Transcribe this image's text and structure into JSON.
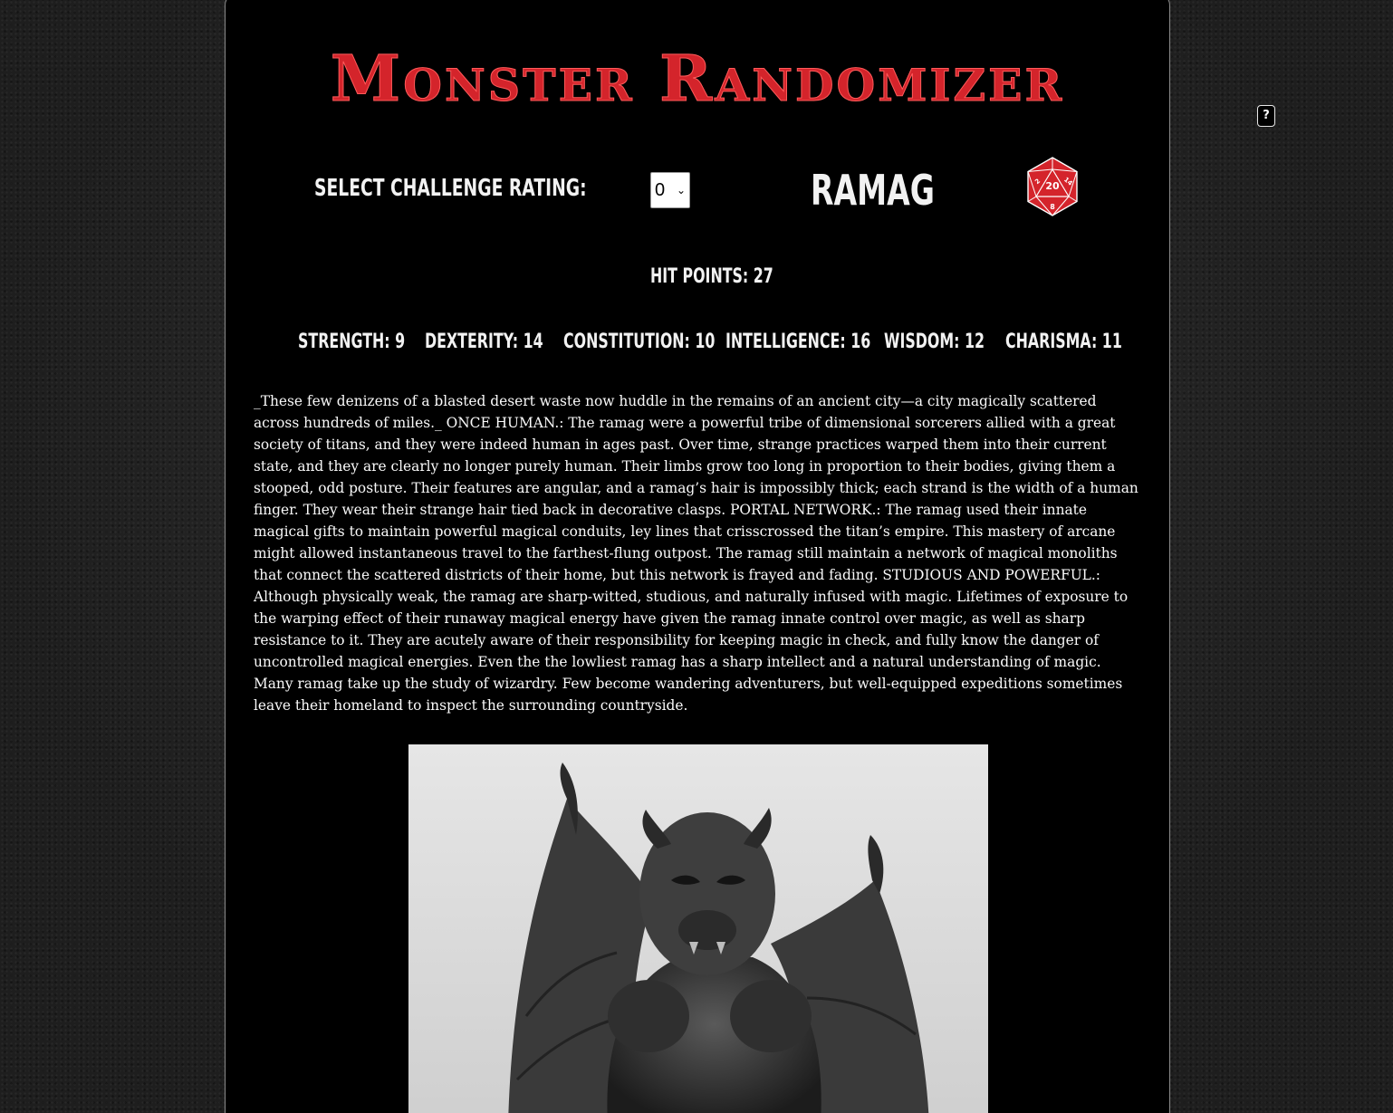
{
  "header": {
    "title": "Monster Randomizer"
  },
  "controls": {
    "challenge_rating_label": "Select Challenge Rating:",
    "challenge_rating_value": "0",
    "help_label": "?",
    "die_label": "20",
    "die_face_numbers": [
      "2",
      "14",
      "8"
    ]
  },
  "monster": {
    "name": "Ramag",
    "hit_points": "Hit Points: 27",
    "stats": [
      {
        "label": "Strength: 9"
      },
      {
        "label": "Dexterity: 14"
      },
      {
        "label": "Constitution: 10"
      },
      {
        "label": "Intelligence: 16"
      },
      {
        "label": "Wisdom: 12"
      },
      {
        "label": "Charisma: 11"
      }
    ],
    "description": "_These few denizens of a blasted desert waste now huddle in the remains of an ancient city—a city magically scattered across hundreds of miles._ ONCE HUMAN.: The ramag were a powerful tribe of dimensional sorcerers allied with a great society of titans, and they were indeed human in ages past. Over time, strange practices warped them into their current state, and they are clearly no longer purely human. Their limbs grow too long in proportion to their bodies, giving them a stooped, odd posture. Their features are angular, and a ramag’s hair is impossibly thick; each strand is the width of a human finger. They wear their strange hair tied back in decorative clasps. PORTAL NETWORK.: The ramag used their innate magical gifts to maintain powerful magical conduits, ley lines that crisscrossed the titan’s empire. This mastery of arcane might allowed instantaneous travel to the farthest-flung outpost. The ramag still maintain a network of magical monoliths that connect the scattered districts of their home, but this network is frayed and fading. STUDIOUS AND POWERFUL.: Although physically weak, the ramag are sharp-witted, studious, and naturally infused with magic. Lifetimes of exposure to the warping effect of their runaway magical energy have given the ramag innate control over magic, as well as sharp resistance to it. They are acutely aware of their responsibility for keeping magic in check, and fully know the danger of uncontrolled magical energies. Even the the lowliest ramag has a sharp intellect and a natural understanding of magic. Many ramag take up the study of wizardry. Few become wandering adventurers, but well-equipped expeditions sometimes leave their homeland to inspect the surrounding countryside."
  },
  "colors": {
    "accent_red": "#d4242b",
    "panel_background": "#000000",
    "page_background": "#232323",
    "text": "#f2f2f2"
  },
  "icons": {
    "die": "d20-icon",
    "help": "help-icon",
    "select_chevron": "chevron-down-icon"
  }
}
